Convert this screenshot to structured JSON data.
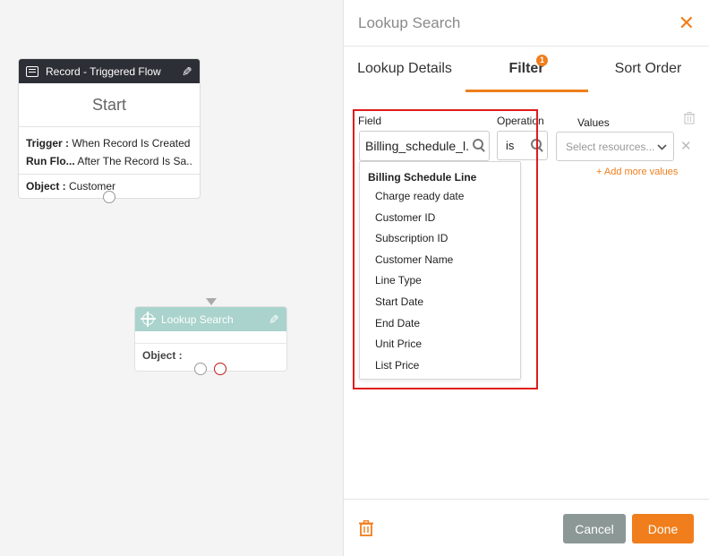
{
  "canvas": {
    "start_node": {
      "header": "Record - Triggered Flow",
      "title": "Start",
      "trigger_label": "Trigger :",
      "trigger_value": "When Record Is Created",
      "run_label": "Run Flo...",
      "run_value": "After The Record Is Sa...",
      "object_label": "Object :",
      "object_value": "Customer"
    },
    "lookup_node": {
      "header": "Lookup Search",
      "object_label": "Object :"
    }
  },
  "panel": {
    "title": "Lookup Search",
    "tabs": [
      {
        "label": "Lookup Details"
      },
      {
        "label": "Filter",
        "badge": "1"
      },
      {
        "label": "Sort Order"
      }
    ],
    "filter": {
      "field_label": "Field",
      "operation_label": "Operation",
      "values_label": "Values",
      "field_value": "Billing_schedule_l...",
      "operation_value": "is",
      "values_placeholder": "Select resources...",
      "add_more": "+ Add more values",
      "dropdown": {
        "group": "Billing Schedule Line",
        "items": [
          "Charge ready date",
          "Customer ID",
          "Subscription ID",
          "Customer Name",
          "Line Type",
          "Start Date",
          "End Date",
          "Unit Price",
          "List Price"
        ]
      }
    },
    "footer": {
      "cancel": "Cancel",
      "done": "Done"
    }
  },
  "colors": {
    "accent": "#f07e1c",
    "start_header": "#2d2f36",
    "lookup_header": "#a9d3cc",
    "highlight": "#e01b1b",
    "cancel_button": "#8c9896"
  },
  "icons": [
    "list-icon",
    "pencil-icon",
    "crosshair-icon",
    "search-icon",
    "chevron-down-icon",
    "close-icon",
    "trash-icon"
  ]
}
